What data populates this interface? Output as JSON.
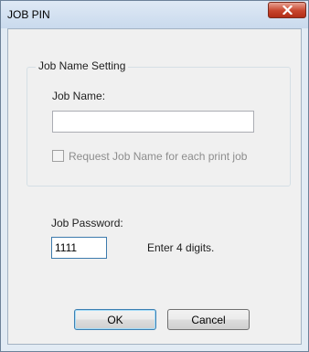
{
  "window": {
    "title": "JOB PIN",
    "close_icon": "close-icon"
  },
  "job_name_group": {
    "legend": "Job Name Setting",
    "job_name_label": "Job Name:",
    "job_name_value": "",
    "request_checkbox_label": "Request Job Name for each print job",
    "request_checkbox_checked": false,
    "request_checkbox_enabled": false
  },
  "password": {
    "label": "Job Password:",
    "value": "1111",
    "hint": "Enter 4 digits."
  },
  "buttons": {
    "ok_label": "OK",
    "cancel_label": "Cancel"
  },
  "colors": {
    "close_button": "#c7442c",
    "window_frame": "#e2ebf4",
    "client_area": "#f0f0f0"
  }
}
